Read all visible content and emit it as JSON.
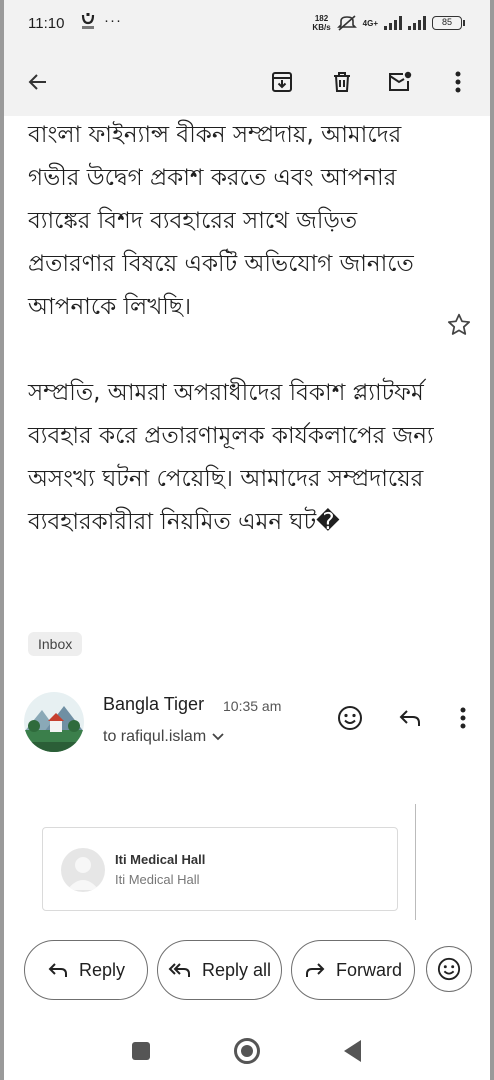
{
  "status_bar": {
    "time": "11:10",
    "more": "···",
    "net_speed_value": "182",
    "net_speed_unit": "KB/s",
    "network_type": "4G+",
    "battery": "85",
    "icons": [
      "notification-icon",
      "mute-icon",
      "signal-icon",
      "battery-icon"
    ]
  },
  "app_bar": {
    "icons": [
      "back-arrow-icon",
      "archive-icon",
      "delete-icon",
      "mark-unread-icon",
      "more-vert-icon"
    ]
  },
  "message": {
    "paragraphs": [
      "বাংলা ফাইন্যান্স বীকন সম্প্রদায়, আমাদের গভীর উদ্বেগ প্রকাশ করতে এবং আপনার ব্যাঙ্কের বিশদ ব্যবহারের সাথে জড়িত প্রতারণার বিষয়ে একটি অভিযোগ জানাতে আপনাকে লিখছি।",
      "সম্প্রতি, আমরা অপরাধীদের বিকাশ প্ল্যাটফর্ম ব্যবহার করে প্রতারণামূলক কার্যকলাপের জন্য অসংখ্য ঘটনা পেয়েছি। আমাদের সম্প্রদায়ের ব্যবহারকারীরা নিয়মিত এমন ঘট�"
    ],
    "label_chip": "Inbox"
  },
  "sender": {
    "name": "Bangla Tiger",
    "time": "10:35 am",
    "recipient": "to rafiqul.islam",
    "icons": [
      "avatar",
      "emoji-react-icon",
      "reply-icon",
      "more-vert-icon"
    ]
  },
  "quoted": {
    "title": "Iti Medical Hall",
    "subtitle": "Iti Medical Hall"
  },
  "actions": {
    "reply": "Reply",
    "reply_all": "Reply all",
    "forward": "Forward"
  },
  "colors": {
    "status_bg": "#f2f2f2",
    "text": "#1f1f1f",
    "border": "#6f6f6f"
  }
}
